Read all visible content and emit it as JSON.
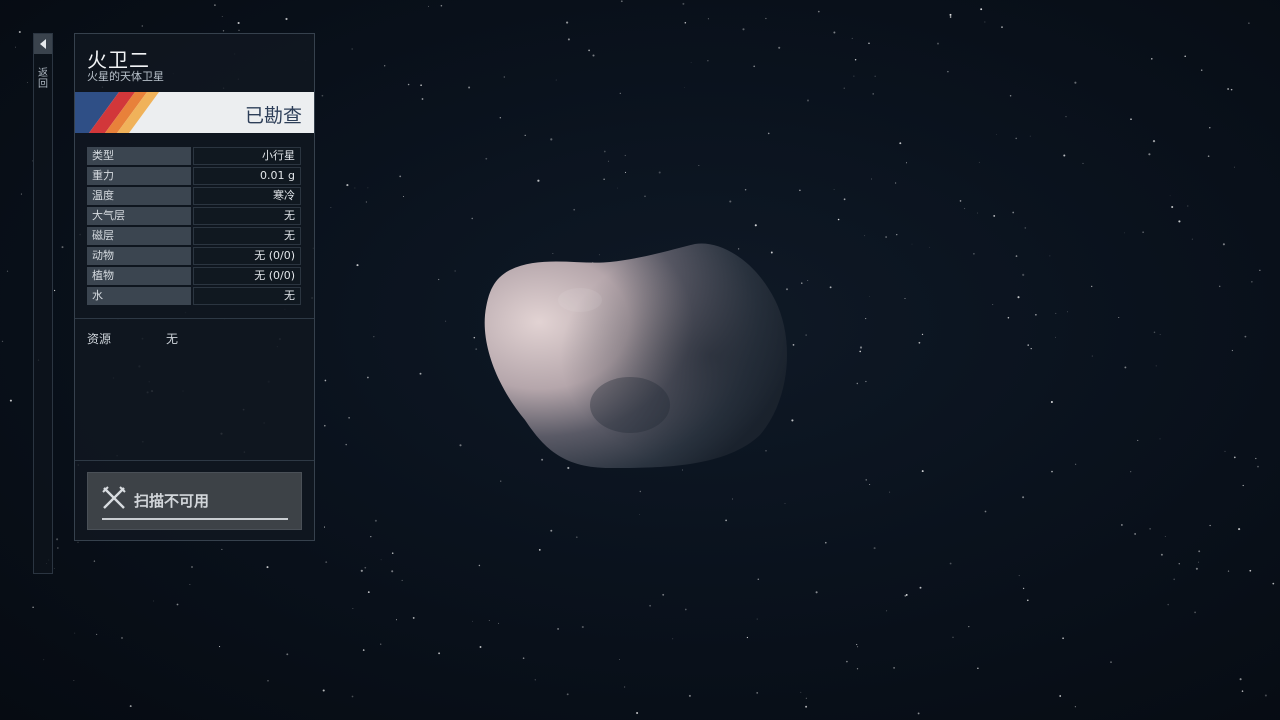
{
  "rail": {
    "label": "返回"
  },
  "panel": {
    "title": "火卫二",
    "subtitle": "火星的天体卫星",
    "status": "已勘查",
    "stats": [
      {
        "label": "类型",
        "value": "小行星"
      },
      {
        "label": "重力",
        "value": "0.01 g"
      },
      {
        "label": "温度",
        "value": "寒冷"
      },
      {
        "label": "大气层",
        "value": "无"
      },
      {
        "label": "磁层",
        "value": "无"
      },
      {
        "label": "动物",
        "value": "无 (0/0)"
      },
      {
        "label": "植物",
        "value": "无 (0/0)"
      },
      {
        "label": "水",
        "value": "无"
      }
    ],
    "resources": {
      "label": "资源",
      "value": "无"
    },
    "scan_button": {
      "label": "扫描不可用",
      "icon": "crossed-tools-icon"
    }
  },
  "colors": {
    "stripe_blue": "#2f4f86",
    "stripe_red": "#d2373a",
    "stripe_orange": "#e8813a",
    "stripe_yellow": "#f0b25a",
    "status_text": "#2d3e58"
  }
}
